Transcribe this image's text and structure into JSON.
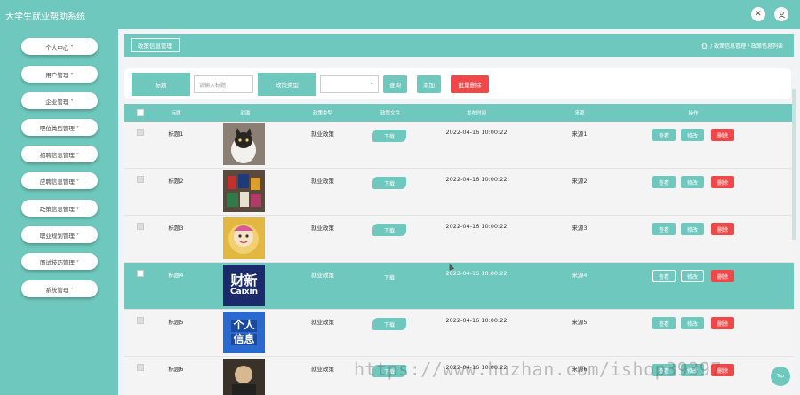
{
  "app": {
    "title": "大学生就业帮助系统"
  },
  "colors": {
    "accent": "#6fc8bd",
    "danger": "#f04848"
  },
  "header": {
    "icons": [
      "fullscreen-icon",
      "user-icon"
    ]
  },
  "sidebar": {
    "items": [
      {
        "label": "个人中心 ˅"
      },
      {
        "label": "用户管理 ˅"
      },
      {
        "label": "企业管理 ˅"
      },
      {
        "label": "职位类型管理 ˅"
      },
      {
        "label": "招聘信息管理 ˅"
      },
      {
        "label": "应聘信息管理 ˅"
      },
      {
        "label": "政策信息管理 ˅"
      },
      {
        "label": "职业规划管理 ˅"
      },
      {
        "label": "面试技巧管理 ˅"
      },
      {
        "label": "系统管理 ˅"
      }
    ]
  },
  "breadcrumb": {
    "title": "政策信息管理",
    "path": "/ 政策信息管理 / 政策信息列表"
  },
  "search": {
    "title_label": "标题",
    "title_placeholder": "请输入标题",
    "type_label": "政策类型",
    "type_value": "",
    "query_button": "查询",
    "add_button": "添加",
    "batch_delete_button": "批量删除"
  },
  "table": {
    "headers": [
      "标题",
      "封面",
      "政策类型",
      "政策文件",
      "发布时间",
      "来源",
      "操作"
    ],
    "rows": [
      {
        "title": "标题1",
        "type": "就业政策",
        "file_button": "下载",
        "time": "2022-04-16 10:00:22",
        "source": "来源1",
        "highlight": false
      },
      {
        "title": "标题2",
        "type": "就业政策",
        "file_button": "下载",
        "time": "2022-04-16 10:00:22",
        "source": "来源2",
        "highlight": false
      },
      {
        "title": "标题3",
        "type": "就业政策",
        "file_button": "下载",
        "time": "2022-04-16 10:00:22",
        "source": "来源3",
        "highlight": false
      },
      {
        "title": "标题4",
        "type": "就业政策",
        "file_button": "下载",
        "time": "2022-04-16 10:00:22",
        "source": "来源4",
        "highlight": true
      },
      {
        "title": "标题5",
        "type": "就业政策",
        "file_button": "下载",
        "time": "2022-04-16 10:00:22",
        "source": "来源5",
        "highlight": false
      },
      {
        "title": "标题6",
        "type": "就业政策",
        "file_button": "下载",
        "time": "2022-04-16 10:00:22",
        "source": "来源6",
        "highlight": false
      }
    ],
    "actions": {
      "view": "查看",
      "edit": "修改",
      "delete": "删除"
    },
    "cover_texts": {
      "r4_line1": "财新",
      "r4_line2": "Caixin",
      "r5_line1": "个人",
      "r5_line2": "信息"
    }
  },
  "watermark": "https://www.huzhan.com/ishop39397",
  "top_button": "Top"
}
